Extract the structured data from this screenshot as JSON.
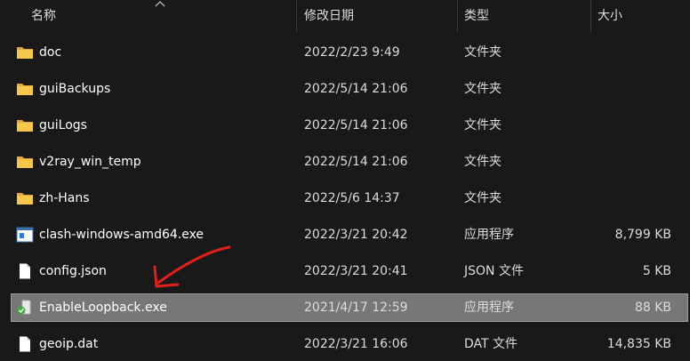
{
  "columns": {
    "name": "名称",
    "date": "修改日期",
    "type": "类型",
    "size": "大小"
  },
  "files": [
    {
      "name": "doc",
      "date": "2022/2/23 9:49",
      "type": "文件夹",
      "size": "",
      "icon": "folder-icon",
      "selected": false
    },
    {
      "name": "guiBackups",
      "date": "2022/5/14 21:06",
      "type": "文件夹",
      "size": "",
      "icon": "folder-icon",
      "selected": false
    },
    {
      "name": "guiLogs",
      "date": "2022/5/14 21:06",
      "type": "文件夹",
      "size": "",
      "icon": "folder-icon",
      "selected": false
    },
    {
      "name": "v2ray_win_temp",
      "date": "2022/5/14 21:06",
      "type": "文件夹",
      "size": "",
      "icon": "folder-icon",
      "selected": false
    },
    {
      "name": "zh-Hans",
      "date": "2022/5/6 14:37",
      "type": "文件夹",
      "size": "",
      "icon": "folder-icon",
      "selected": false
    },
    {
      "name": "clash-windows-amd64.exe",
      "date": "2022/3/21 20:42",
      "type": "应用程序",
      "size": "8,799 KB",
      "icon": "exe-window-icon",
      "selected": false
    },
    {
      "name": "config.json",
      "date": "2022/3/21 20:41",
      "type": "JSON 文件",
      "size": "5 KB",
      "icon": "file-icon",
      "selected": false
    },
    {
      "name": "EnableLoopback.exe",
      "date": "2021/4/17 12:59",
      "type": "应用程序",
      "size": "88 KB",
      "icon": "exe-app-icon",
      "selected": true
    },
    {
      "name": "geoip.dat",
      "date": "2022/3/21 16:06",
      "type": "DAT 文件",
      "size": "14,835 KB",
      "icon": "file-icon",
      "selected": false
    }
  ],
  "colors": {
    "background": "#191919",
    "selection": "#777777",
    "folder": "#f2c14e",
    "annotation_arrow": "#e0201b"
  }
}
